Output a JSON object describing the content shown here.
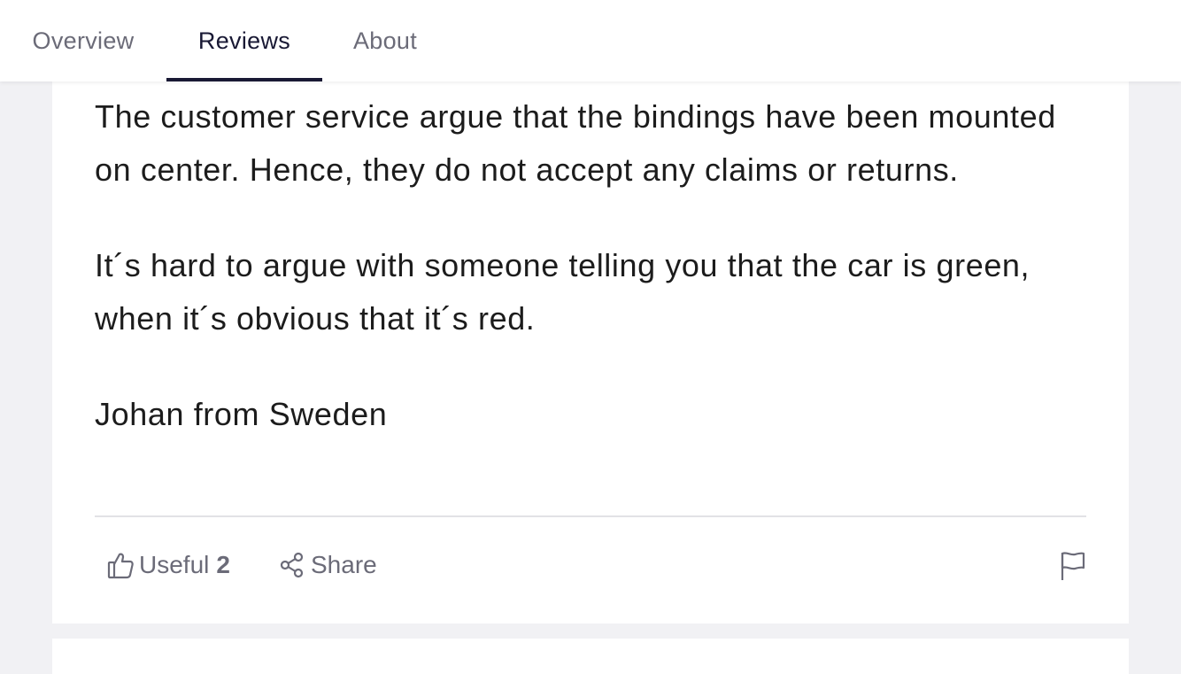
{
  "tabs": [
    {
      "label": "Overview",
      "active": false
    },
    {
      "label": "Reviews",
      "active": true
    },
    {
      "label": "About",
      "active": false
    }
  ],
  "review": {
    "paragraphs": [
      "The customer service argue that the bindings have been mounted on center. Hence, they do not accept any claims or returns.",
      "It´s hard to argue with someone telling you that the car is green, when it´s obvious that it´s red.",
      "Johan from Sweden"
    ]
  },
  "actions": {
    "useful_label": "Useful",
    "useful_count": "2",
    "share_label": "Share",
    "useful_icon": "thumbs-up-icon",
    "share_icon": "share-icon",
    "report_icon": "flag-icon"
  },
  "colors": {
    "accent": "#191934",
    "muted": "#6b6b78",
    "background": "#f1f1f4"
  }
}
